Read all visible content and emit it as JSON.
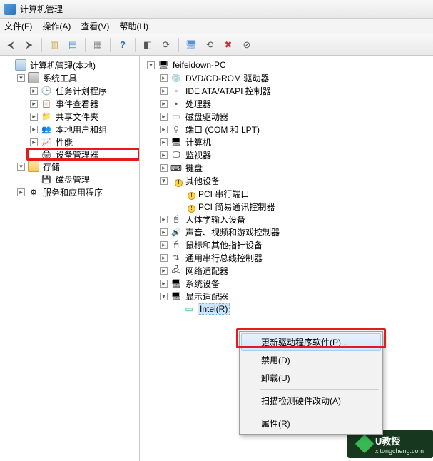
{
  "window": {
    "title": "计算机管理"
  },
  "menu": {
    "file": "文件(F)",
    "action": "操作(A)",
    "view": "查看(V)",
    "help": "帮助(H)"
  },
  "left": {
    "root": "计算机管理(本地)",
    "systools": "系统工具",
    "sched": "任务计划程序",
    "event": "事件查看器",
    "share": "共享文件夹",
    "users": "本地用户和组",
    "perf": "性能",
    "devmgr": "设备管理器",
    "storage": "存储",
    "diskmgmt": "磁盘管理",
    "services": "服务和应用程序"
  },
  "right": {
    "root": "feifeidown-PC",
    "dvd": "DVD/CD-ROM 驱动器",
    "ide": "IDE ATA/ATAPI 控制器",
    "cpu": "处理器",
    "diskdrv": "磁盘驱动器",
    "ports": "端口 (COM 和 LPT)",
    "computer": "计算机",
    "monitor": "监视器",
    "keyboard": "键盘",
    "other": "其他设备",
    "pci_serial": "PCI 串行端口",
    "pci_comm": "PCI 简易通讯控制器",
    "hid": "人体学输入设备",
    "sound": "声音、视频和游戏控制器",
    "mouse": "鼠标和其他指针设备",
    "usb": "通用串行总线控制器",
    "net": "网络适配器",
    "sysdev": "系统设备",
    "display": "显示适配器",
    "gpu": "Intel(R) "
  },
  "ctx": {
    "update": "更新驱动程序软件(P)...",
    "disable": "禁用(D)",
    "uninstall": "卸载(U)",
    "scan": "扫描检测硬件改动(A)",
    "props": "属性(R)"
  },
  "wm": {
    "t": "U教授",
    "s": "xitongcheng.com"
  }
}
